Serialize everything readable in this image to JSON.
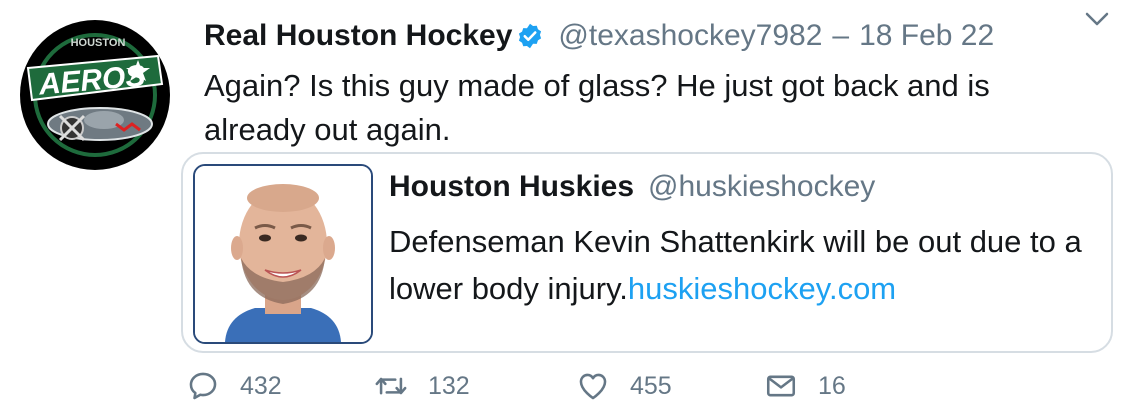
{
  "tweet": {
    "author_name": "Real Houston Hockey",
    "handle": "@texashockey7982",
    "separator": "–",
    "date": "18 Feb 22",
    "text": "Again? Is this guy made of glass? He just got back and is already out again.",
    "avatar_logo_text": "AEROS",
    "avatar_logo_subtext": "HOUSTON"
  },
  "quoted": {
    "author_name": "Houston Huskies",
    "handle": "@huskieshockey",
    "text": "Defenseman Kevin Shattenkirk will be out due to a lower body injury.",
    "link": "huskieshockey.com"
  },
  "actions": {
    "reply_count": "432",
    "retweet_count": "132",
    "like_count": "455",
    "dm_count": "16"
  },
  "icons": {
    "verified": "verified-badge-icon",
    "caret": "chevron-down-icon",
    "reply": "reply-icon",
    "retweet": "retweet-icon",
    "like": "heart-icon",
    "dm": "envelope-icon"
  },
  "colors": {
    "link": "#1da1f2",
    "muted": "#657786",
    "text": "#14171a",
    "border": "#d6dde3",
    "logo_green": "#1e6b3c"
  }
}
